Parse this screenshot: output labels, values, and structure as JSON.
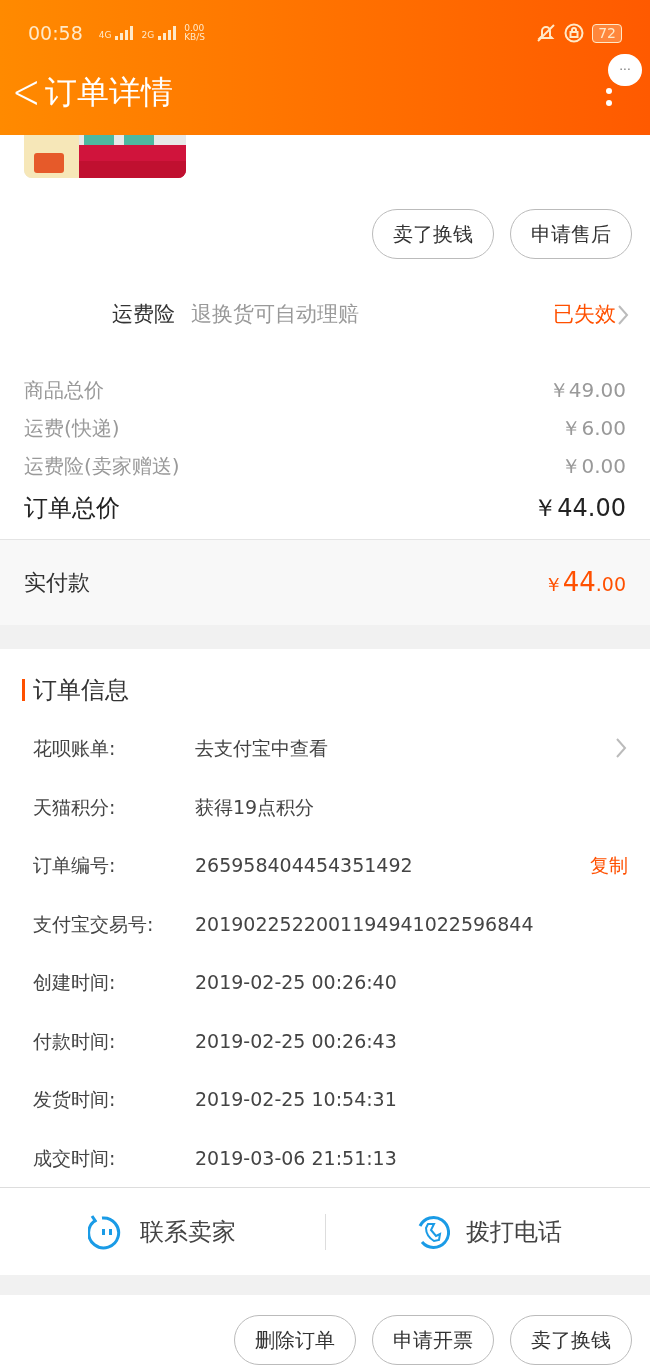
{
  "status_bar": {
    "time": "00:58",
    "network_1": "4G",
    "network_2": "2G",
    "speed": "0.00",
    "speed_unit": "KB/S",
    "battery": "72"
  },
  "header": {
    "back": "<",
    "title": "订单详情",
    "more": "···"
  },
  "product": {
    "kind": "picture"
  },
  "top_actions": [
    "卖了换钱",
    "申请售后"
  ],
  "insurance": {
    "name": "运费险",
    "desc": "退换货可自动理赔",
    "status": "已失效"
  },
  "prices": [
    {
      "label": "商品总价",
      "value": "￥49.00"
    },
    {
      "label": "运费(快递)",
      "value": "￥6.00"
    },
    {
      "label": "运费险(卖家赠送)",
      "value": "￥0.00"
    }
  ],
  "total": {
    "label": "订单总价",
    "value": "￥44.00"
  },
  "paid": {
    "label": "实付款",
    "currency": "￥",
    "integer": "44",
    "decimal": ".00"
  },
  "order_info": {
    "title": "订单信息",
    "rows": [
      {
        "label": "花呗账单:",
        "value": "去支付宝中查看",
        "kind": "link"
      },
      {
        "label": "天猫积分:",
        "value": "获得19点积分",
        "kind": "plain"
      },
      {
        "label": "订单编号:",
        "value": "265958404454351492",
        "kind": "copy",
        "action": "复制"
      },
      {
        "label": "支付宝交易号:",
        "value": "2019022522001194941022596844",
        "kind": "plain"
      },
      {
        "label": "创建时间:",
        "value": "2019-02-25 00:26:40",
        "kind": "plain"
      },
      {
        "label": "付款时间:",
        "value": "2019-02-25 00:26:43",
        "kind": "plain"
      },
      {
        "label": "发货时间:",
        "value": "2019-02-25 10:54:31",
        "kind": "plain"
      },
      {
        "label": "成交时间:",
        "value": "2019-03-06 21:51:13",
        "kind": "plain"
      }
    ]
  },
  "contact": [
    {
      "label": "联系卖家",
      "kind": "chat"
    },
    {
      "label": "拨打电话",
      "kind": "phone"
    }
  ],
  "bottom_actions": [
    "删除订单",
    "申请开票",
    "卖了换钱"
  ]
}
